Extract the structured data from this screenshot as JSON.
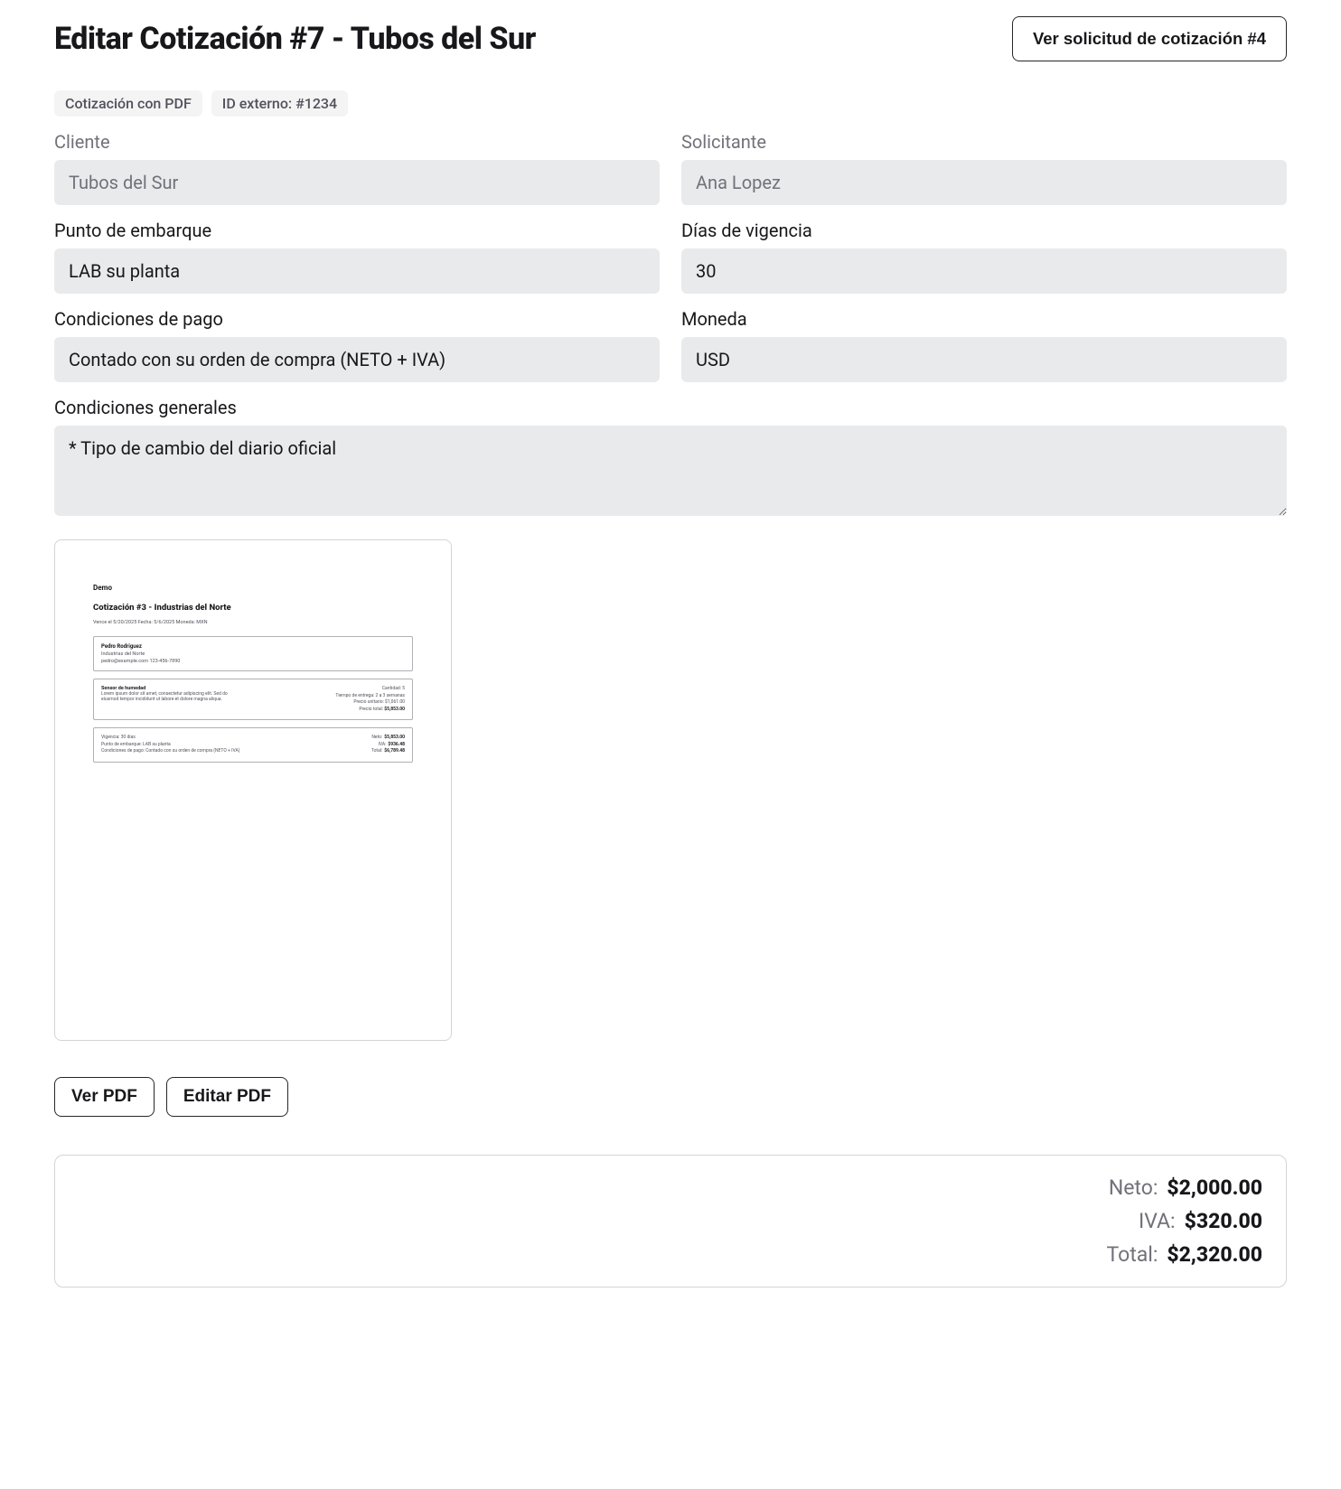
{
  "header": {
    "title": "Editar Cotización #7 - Tubos del Sur",
    "view_request_button": "Ver solicitud de cotización #4"
  },
  "badges": {
    "pdf": "Cotización con PDF",
    "external_id": "ID externo: #1234"
  },
  "form": {
    "cliente": {
      "label": "Cliente",
      "value": "Tubos del Sur"
    },
    "solicitante": {
      "label": "Solicitante",
      "value": "Ana Lopez"
    },
    "punto_embarque": {
      "label": "Punto de embarque",
      "value": "LAB su planta"
    },
    "dias_vigencia": {
      "label": "Días de vigencia",
      "value": "30"
    },
    "condiciones_pago": {
      "label": "Condiciones de pago",
      "value": "Contado con su orden de compra (NETO + IVA)"
    },
    "moneda": {
      "label": "Moneda",
      "value": "USD"
    },
    "condiciones_generales": {
      "label": "Condiciones generales",
      "value": "* Tipo de cambio del diario oficial"
    }
  },
  "pdf_preview": {
    "company": "Demo",
    "title": "Cotización #3 - Industrias del Norte",
    "meta": "Vence el 5/20/2025  Fecha: 5/6/2025  Moneda: MXN",
    "contact": {
      "name": "Pedro Rodriguez",
      "company": "Industrias del Norte",
      "email_phone": "pedro@example.com  123-456-7890"
    },
    "item": {
      "name": "Sensor de humedad",
      "desc": "Lorem ipsum dolor sit amet, consectetur adipiscing elit. Sed do eiusmod tempor incididunt ut labore et dolore magna aliqua.",
      "qty": "Cantidad: 5",
      "lead": "Tiempo de entrega: 2 a 3 semanas",
      "unit": "Precio unitario: $1,061.00",
      "total_label": "Precio total:",
      "total_value": "$5,853.00"
    },
    "footer": {
      "vigencia": "Vigencia: 30 días",
      "embarque": "Punto de embarque: LAB su planta",
      "pago": "Condiciones de pago: Contado con su orden de compra (NETO + IVA)",
      "neto_label": "Neto:",
      "neto_val": "$5,853.00",
      "iva_label": "IVA:",
      "iva_val": "$936.48",
      "total_label": "Total:",
      "total_val": "$6,789.48"
    }
  },
  "pdf_buttons": {
    "view": "Ver PDF",
    "edit": "Editar PDF"
  },
  "totals": {
    "neto": {
      "label": "Neto:",
      "value": "$2,000.00"
    },
    "iva": {
      "label": "IVA:",
      "value": "$320.00"
    },
    "total": {
      "label": "Total:",
      "value": "$2,320.00"
    }
  }
}
